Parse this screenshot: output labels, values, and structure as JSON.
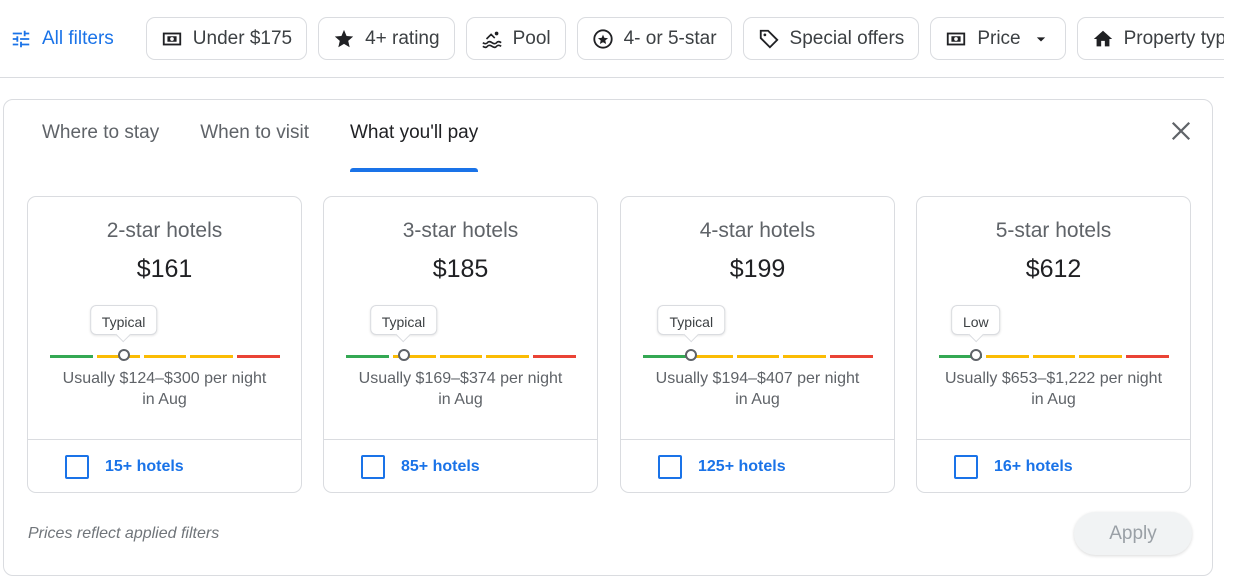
{
  "filters": {
    "all_filters": "All filters",
    "chips": [
      {
        "label": "Under $175",
        "icon": "money-icon"
      },
      {
        "label": "4+ rating",
        "icon": "star-icon"
      },
      {
        "label": "Pool",
        "icon": "pool-icon"
      },
      {
        "label": "4- or 5-star",
        "icon": "star-circle-icon"
      },
      {
        "label": "Special offers",
        "icon": "tag-icon"
      },
      {
        "label": "Price",
        "icon": "money-icon",
        "dropdown": true
      },
      {
        "label": "Property type",
        "icon": "home-icon"
      }
    ]
  },
  "panel": {
    "tabs": [
      "Where to stay",
      "When to visit",
      "What you'll pay"
    ],
    "active_tab": 2,
    "cards": [
      {
        "title": "2-star hotels",
        "price": "$161",
        "level": "Typical",
        "position_pct": 32,
        "range": "Usually $124–$300 per night",
        "month": "in Aug",
        "count": "15+ hotels"
      },
      {
        "title": "3-star hotels",
        "price": "$185",
        "level": "Typical",
        "position_pct": 25,
        "range": "Usually $169–$374 per night",
        "month": "in Aug",
        "count": "85+ hotels"
      },
      {
        "title": "4-star hotels",
        "price": "$199",
        "level": "Typical",
        "position_pct": 21,
        "range": "Usually $194–$407 per night",
        "month": "in Aug",
        "count": "125+ hotels"
      },
      {
        "title": "5-star hotels",
        "price": "$612",
        "level": "Low",
        "position_pct": 16,
        "range": "Usually $653–$1,222 per night",
        "month": "in Aug",
        "count": "16+ hotels"
      }
    ],
    "note": "Prices reflect applied filters",
    "apply": "Apply"
  },
  "colors": {
    "accent": "#1a73e8",
    "low": "#34a853",
    "typical": "#fbbc04",
    "high": "#ea4335"
  }
}
